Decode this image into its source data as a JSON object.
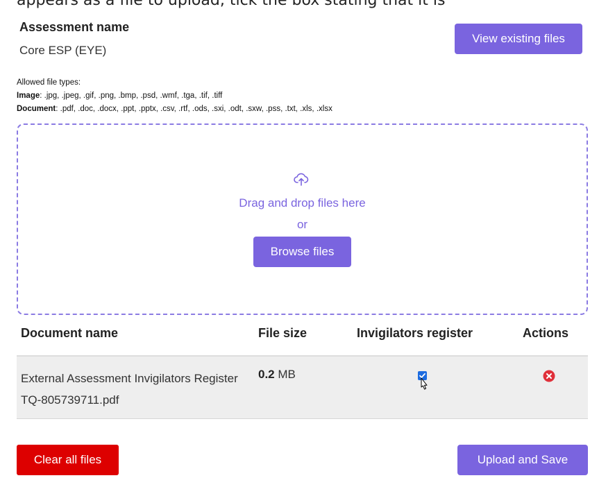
{
  "top_text": "appears as a file to upload, tick the box stating that it is",
  "assessment": {
    "label": "Assessment name",
    "value": "Core ESP (EYE)"
  },
  "view_files_label": "View existing files",
  "allowed": {
    "heading": "Allowed file types",
    "image_label": "Image",
    "image_types": ".jpg, .jpeg, .gif, .png, .bmp, .psd, .wmf, .tga, .tif, .tiff",
    "document_label": "Document",
    "document_types": ".pdf, .doc, .docx, .ppt, .pptx, .csv, .rtf, .ods, .sxi, .odt, .sxw, .pss, .txt, .xls, .xlsx"
  },
  "dropzone": {
    "drag_text": "Drag and drop files here",
    "or_text": "or",
    "browse_label": "Browse files"
  },
  "table": {
    "headers": [
      "Document name",
      "File size",
      "Invigilators register",
      "Actions"
    ],
    "rows": [
      {
        "name": "External Assessment Invigilators Register TQ-805739711.pdf",
        "size_value": "0.2",
        "size_unit": "MB",
        "invigilators_register": true
      }
    ]
  },
  "footer": {
    "clear_label": "Clear all files",
    "upload_label": "Upload and Save"
  },
  "colors": {
    "accent": "#7a64df",
    "danger": "#dd0000",
    "checkbox": "#1d6ce0",
    "remove": "#e0303a"
  }
}
